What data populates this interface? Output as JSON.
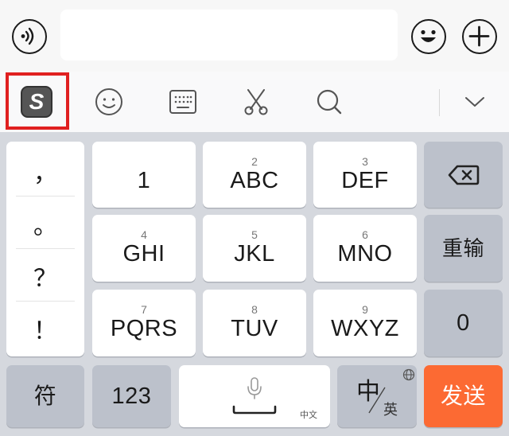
{
  "input_bar": {
    "message_value": "",
    "voice_icon": "voice-icon",
    "emoji_icon": "emoji-icon",
    "plus_icon": "plus-icon"
  },
  "toolbar": {
    "logo_letter": "S",
    "logo_icon": "sogou-logo-icon",
    "items": [
      "smiley-icon",
      "keyboard-icon",
      "scissors-icon",
      "search-icon",
      "chevron-down-icon"
    ],
    "highlight_color": "#e02020"
  },
  "keyboard": {
    "symbols": [
      "，",
      "。",
      "？",
      "！"
    ],
    "rows": [
      [
        {
          "num": "",
          "label": "1"
        },
        {
          "num": "2",
          "label": "ABC"
        },
        {
          "num": "3",
          "label": "DEF"
        }
      ],
      [
        {
          "num": "4",
          "label": "GHI"
        },
        {
          "num": "5",
          "label": "JKL"
        },
        {
          "num": "6",
          "label": "MNO"
        }
      ],
      [
        {
          "num": "7",
          "label": "PQRS"
        },
        {
          "num": "8",
          "label": "TUV"
        },
        {
          "num": "9",
          "label": "WXYZ"
        }
      ]
    ],
    "delete_icon": "backspace-icon",
    "retype_label": "重输",
    "zero_label": "0",
    "bottom": {
      "symbol_label": "符",
      "numeric_label": "123",
      "space_hint": "中文",
      "space_icon": "microphone-icon",
      "lang_zh": "中",
      "lang_en": "英",
      "globe_icon": "globe-icon",
      "send_label": "发送"
    },
    "colors": {
      "background": "#d5d8de",
      "key": "#ffffff",
      "function_key": "#bcc1cb",
      "send_key": "#fc6a33"
    }
  }
}
